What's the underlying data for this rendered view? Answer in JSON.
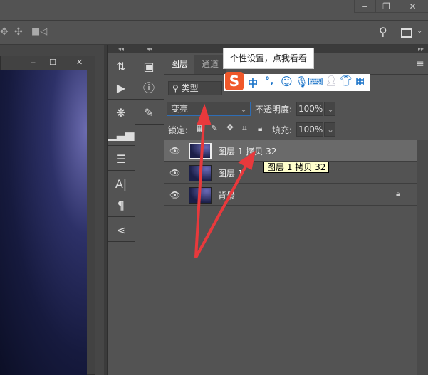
{
  "window": {
    "minimize": "‒",
    "restore": "❐",
    "close": "✕"
  },
  "doc_window": {
    "minimize": "‒",
    "maximize": "☐",
    "close": "✕"
  },
  "collapse_left": "◂◂",
  "collapse_right": "▸▸",
  "layers_panel": {
    "tabs": [
      {
        "label": "图层",
        "active": true
      },
      {
        "label": "通道",
        "active": false
      }
    ],
    "filter_kind": "类型",
    "blend_mode": "变亮",
    "opacity_label": "不透明度:",
    "opacity_value": "100%",
    "lock_label": "锁定:",
    "fill_label": "填充:",
    "fill_value": "100%",
    "layers": [
      {
        "name": "图层 1 拷贝 32",
        "selected": true,
        "locked": false
      },
      {
        "name": "图层 1",
        "selected": false,
        "locked": false
      },
      {
        "name": "背景",
        "selected": false,
        "locked": true
      }
    ],
    "tooltip": "图层 1 拷贝 32"
  },
  "ime": {
    "tip": "个性设置，点我看看",
    "logo": "S",
    "lang": "中",
    "punct": "°,"
  },
  "colors": {
    "accent": "#2e6db5",
    "arrow": "#e8393c",
    "ime_blue": "#1a73c8",
    "ime_logo": "#f0582a",
    "tooltip_bg": "#ffffcc"
  }
}
